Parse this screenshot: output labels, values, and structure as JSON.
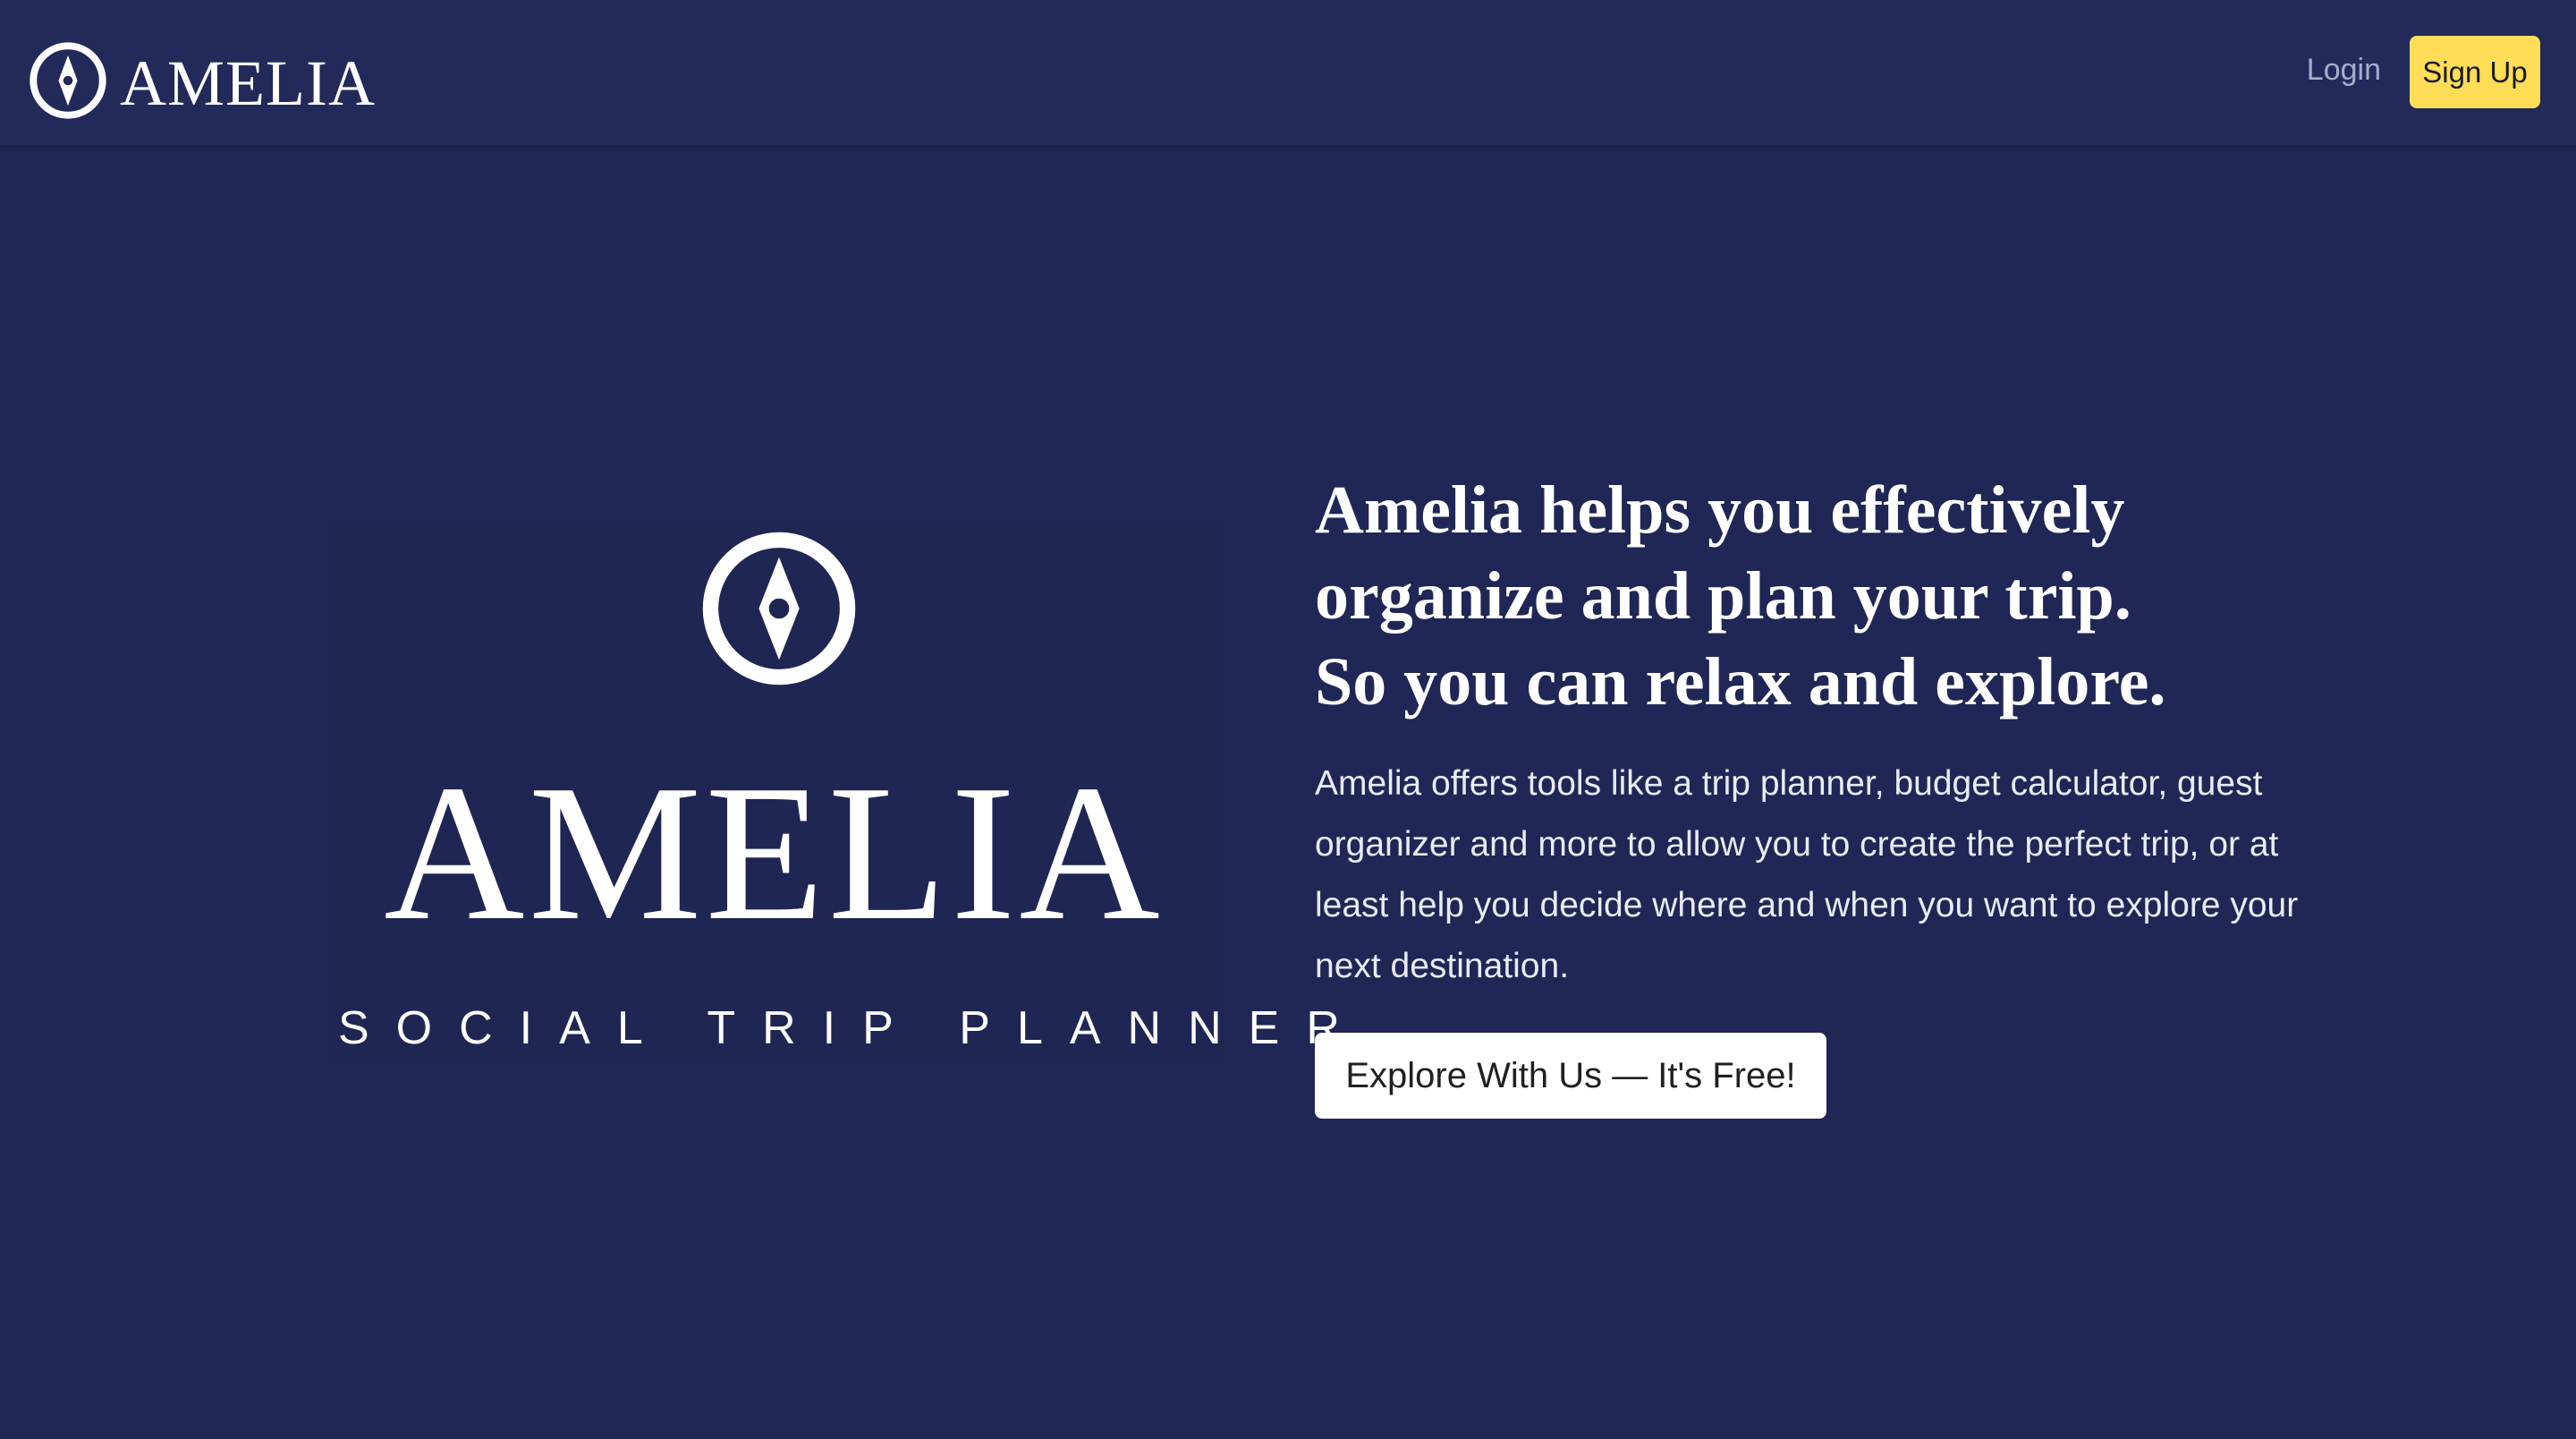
{
  "header": {
    "brand_name": "AMELIA",
    "login_label": "Login",
    "signup_label": "Sign Up",
    "logo_icon": "compass-icon"
  },
  "hero": {
    "logo_icon": "compass-icon",
    "logo_name": "AMELIA",
    "logo_tagline": "SOCIAL TRIP PLANNER",
    "headline_lines": [
      "Amelia helps you effectively",
      "organize and plan your trip.",
      "So you can relax and explore."
    ],
    "description": "Amelia offers tools like a trip planner, budget calculator, guest organizer and more to allow you to create the perfect trip, or at least help you decide where and when you want to explore your next destination.",
    "cta_label": "Explore With Us — It's Free!"
  },
  "colors": {
    "background": "#202756",
    "navbar": "#222a5a",
    "signup_button": "#ffdd57",
    "cta_button": "#ffffff",
    "text": "#ffffff"
  }
}
